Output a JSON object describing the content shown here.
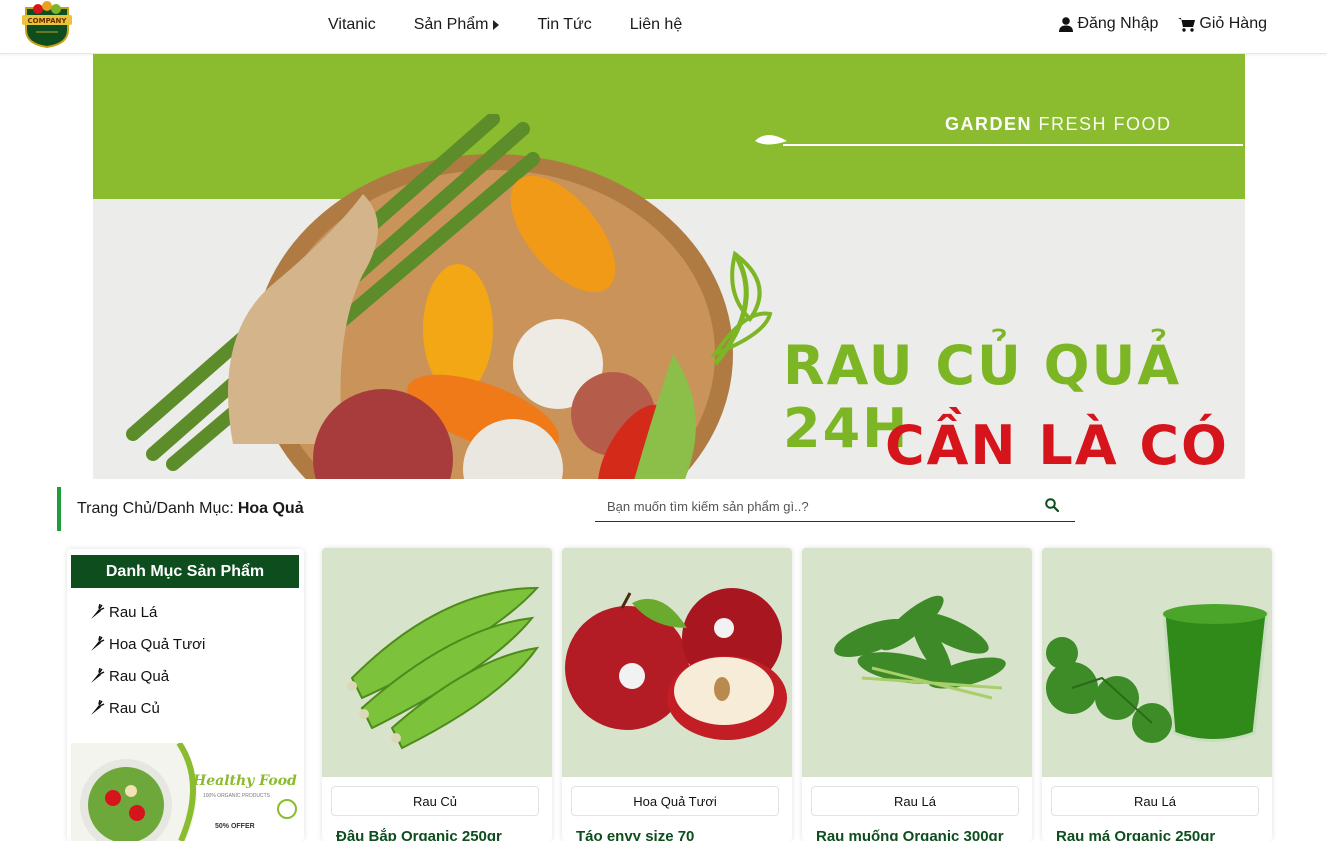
{
  "brand": {
    "logo_text": "COMPANY"
  },
  "nav": {
    "items": [
      {
        "label": "Vitanic"
      },
      {
        "label": "Sản Phẩm"
      },
      {
        "label": "Tin Tức"
      },
      {
        "label": "Liên hệ"
      }
    ],
    "login_label": "Đăng Nhập",
    "cart_label": "Giỏ Hàng"
  },
  "banner": {
    "tagline_bold": "GARDEN",
    "tagline_rest": "FRESH FOOD",
    "headline_1": "RAU CỦ QUẢ 24H",
    "headline_2": "CẦN LÀ CÓ"
  },
  "breadcrumb": {
    "prefix": "Trang Chủ/Danh Mục:",
    "current": "Hoa Quả"
  },
  "search": {
    "placeholder": "Bạn muốn tìm kiếm sản phẩm gì..?",
    "value": ""
  },
  "sidebar": {
    "title": "Danh Mục Sản Phẩm",
    "items": [
      {
        "label": "Rau Lá"
      },
      {
        "label": "Hoa Quả Tươi"
      },
      {
        "label": "Rau Quả"
      },
      {
        "label": "Rau Củ"
      }
    ],
    "ad": {
      "title": "Healthy Food",
      "subtitle": "100% ORGANIC PRODUCTS",
      "offer": "50% OFFER"
    }
  },
  "products": [
    {
      "category": "Rau Củ",
      "name": "Đậu Bắp Organic 250gr"
    },
    {
      "category": "Hoa Quả Tươi",
      "name": "Táo envy size 70"
    },
    {
      "category": "Rau Lá",
      "name": "Rau muống Organic 300gr"
    },
    {
      "category": "Rau Lá",
      "name": "Rau má Organic 250gr"
    }
  ],
  "colors": {
    "brand_green": "#0d4d1e",
    "accent_green": "#1f9d3a",
    "banner_green": "#8bbb2e",
    "headline_red": "#d6141b",
    "card_bg": "#d8e3cc"
  }
}
